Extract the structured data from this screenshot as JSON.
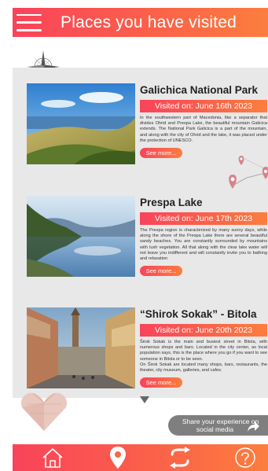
{
  "header": {
    "title": "Places you have visited"
  },
  "places": [
    {
      "title": "Galichica National Park",
      "visited": "Visited on: June 16th 2023",
      "description": "In the southwestern part of Macedonia, like a separator that divides Ohrid and Prespa Lake, the beautiful mountain Galicica extends. The National Park Galicica is a part of the mountain, and along with the city of Ohrid and the lake, it was placed under the protection of UNESCO.",
      "see_more": "See more..."
    },
    {
      "title": "Prespa Lake",
      "visited": "Visited on: June 17th 2023",
      "description": "The Prespa region is characterized by many sunny days, while along the shore of the Prespa Lake there are several beautiful sandy beaches. You are constantly surrounded by mountains with lush vegetation. All that along with the clear lake water will not leave you indifferent and will constantly invite you to bathing and relaxation",
      "see_more": "See more..."
    },
    {
      "title": "“Shirok Sokak” - Bitola",
      "visited": "Visited on: June 20th 2023",
      "description_1": "Širok Sokak is the main and busiest street in Bitola, with numerous shops and bars. Located in the city center, as local population says, this is the place where you go if you want to see someone in Bitola or to be seen.",
      "description_2": "On Širok Sokak are located many shops, bars, restaurants, the theater, city museum, galleries, and cafes.",
      "see_more": "See more..."
    }
  ],
  "share": {
    "line1": "Share your experience on",
    "line2": "social media"
  },
  "icons": {
    "menu": "hamburger-menu-icon",
    "compass": "compass-rose-icon",
    "map": "map-pins-icon",
    "origami": "origami-heart-icon",
    "scroll": "scroll-down-arrow-icon",
    "share": "share-arrow-icon",
    "home": "home-icon",
    "location": "location-pin-icon",
    "swap": "swap-arrows-icon",
    "help": "help-question-icon"
  },
  "colors": {
    "accent_start": "#f9435a",
    "accent_end": "#fc7e3e",
    "panel": "#e8e8e8",
    "share_bg": "#7f7f7f"
  }
}
